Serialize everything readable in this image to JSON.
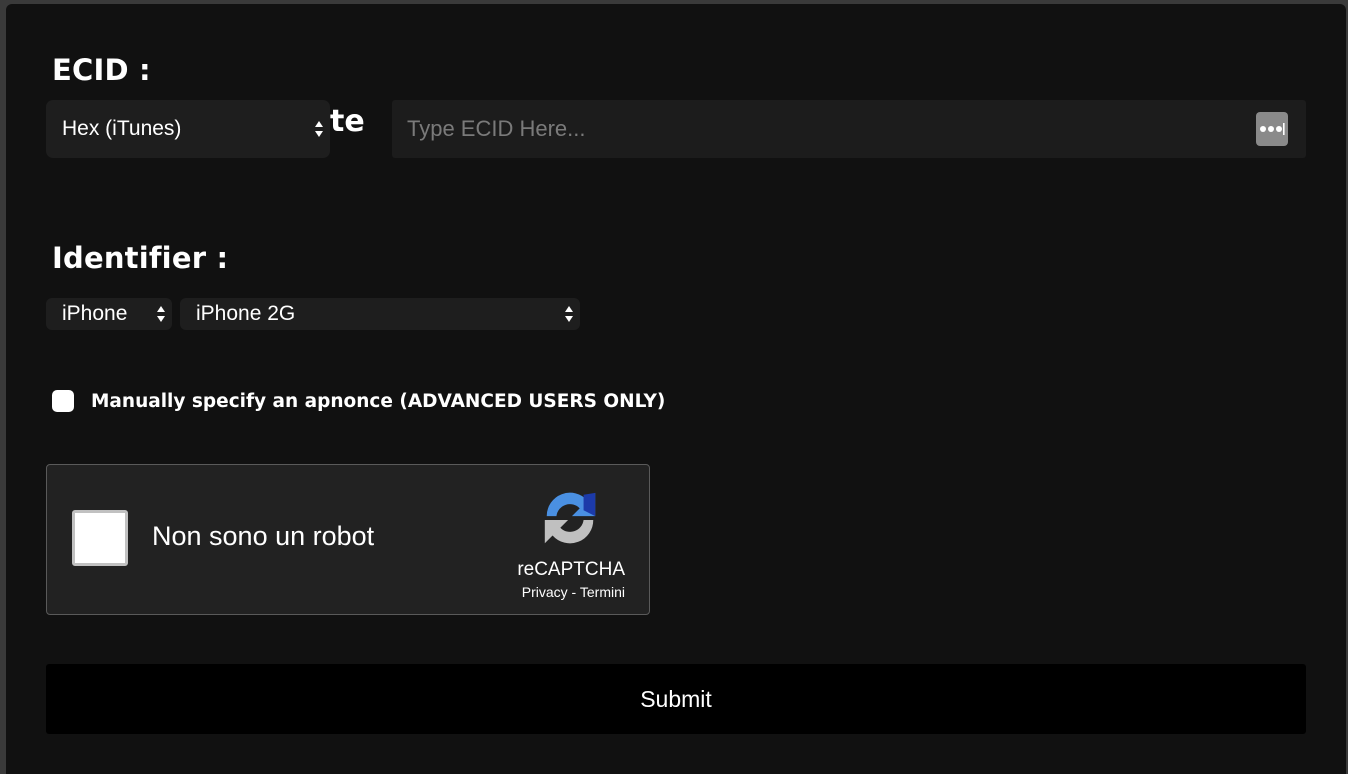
{
  "ecid": {
    "heading": "ECID :",
    "format_select": {
      "selected": "Hex (iTunes)"
    },
    "overlap_text": "te",
    "input": {
      "placeholder": "Type ECID Here...",
      "value": ""
    },
    "password_icon": "password-manager-dots-icon"
  },
  "identifier": {
    "heading": "Identifier :",
    "device_type_select": {
      "selected": "iPhone"
    },
    "device_model_select": {
      "selected": "iPhone 2G"
    }
  },
  "advanced": {
    "label": "Manually specify an apnonce (ADVANCED USERS ONLY)",
    "checked": false
  },
  "recaptcha": {
    "label": "Non sono un robot",
    "brand": "reCAPTCHA",
    "privacy_link": "Privacy",
    "separator": " - ",
    "terms_link": "Termini",
    "logo_icon": "recaptcha-logo-icon"
  },
  "submit": {
    "label": "Submit"
  },
  "colors": {
    "panel_bg": "#111111",
    "field_bg": "#1e1e1e",
    "recaptcha_bg": "#222222",
    "submit_bg": "#000000",
    "text": "#ffffff",
    "placeholder": "#7a7a7a"
  }
}
